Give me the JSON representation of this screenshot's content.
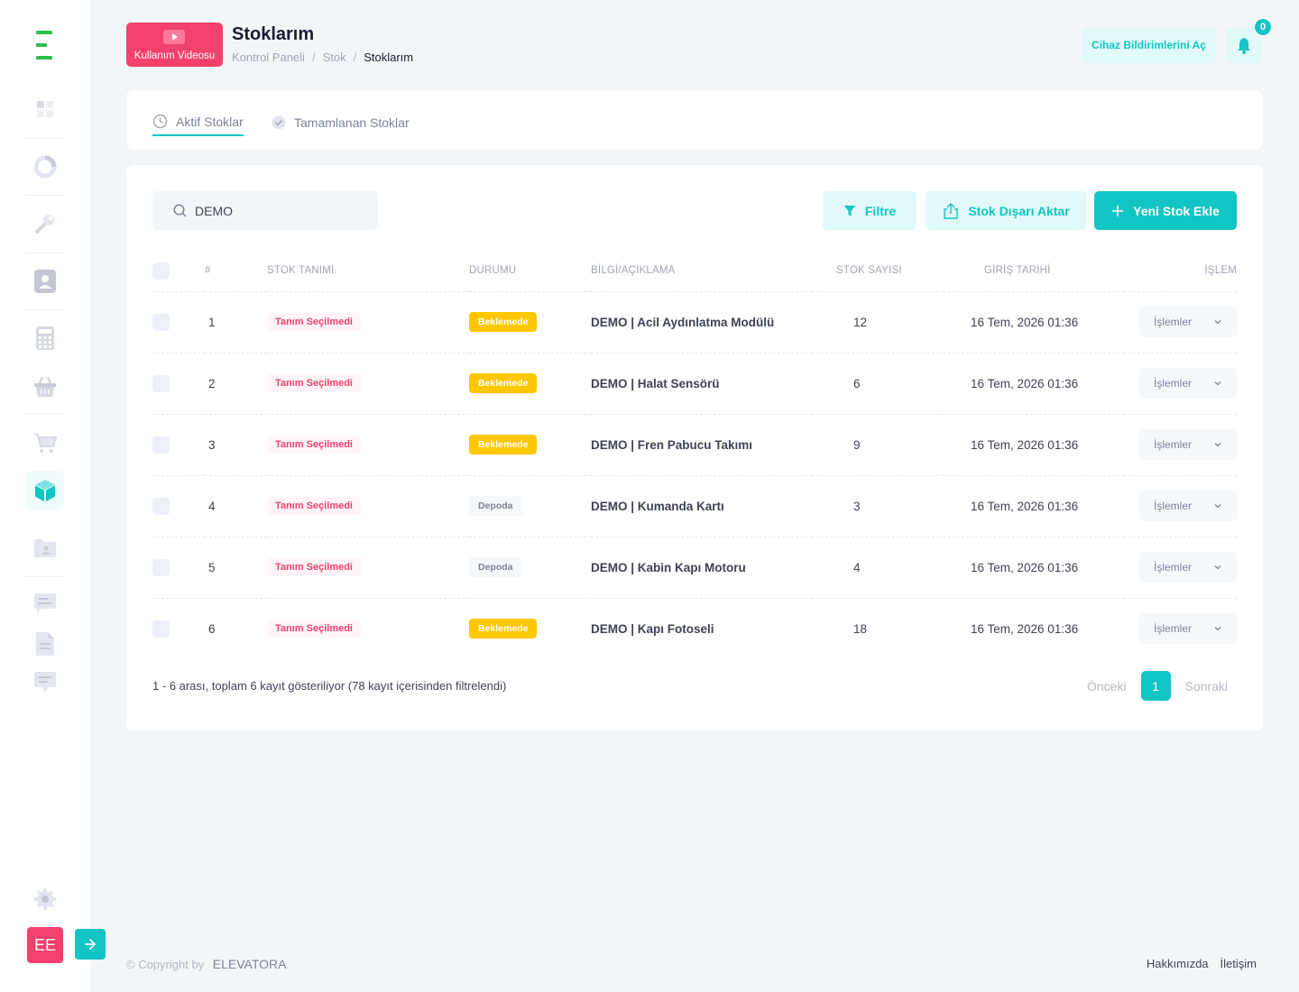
{
  "header": {
    "video_button_label": "Kullanım Videosu",
    "title": "Stoklarım",
    "breadcrumb": [
      "Kontrol Paneli",
      "Stok",
      "Stoklarım"
    ],
    "device_notifications_label": "Cihaz Bildirimlerini Aç",
    "notification_count": "0"
  },
  "tabs": [
    {
      "label": "Aktif Stoklar",
      "active": true
    },
    {
      "label": "Tamamlanan Stoklar",
      "active": false
    }
  ],
  "toolbar": {
    "search_value": "DEMO",
    "filter_label": "Filtre",
    "export_label": "Stok Dışarı Aktar",
    "add_label": "Yeni Stok Ekle"
  },
  "table": {
    "columns": [
      "#",
      "STOK TANIMI",
      "DURUMU",
      "BİLGİ/AÇIKLAMA",
      "STOK SAYISI",
      "GİRİŞ TARİHİ",
      "İŞLEM"
    ],
    "rows": [
      {
        "no": "1",
        "definition": "Tanım Seçilmedi",
        "status": "Beklemede",
        "status_type": "warning",
        "info": "DEMO | Acil Aydınlatma Modülü",
        "count": "12",
        "date": "16 Tem, 2026 01:36",
        "action": "İşlemler"
      },
      {
        "no": "2",
        "definition": "Tanım Seçilmedi",
        "status": "Beklemede",
        "status_type": "warning",
        "info": "DEMO | Halat Sensörü",
        "count": "6",
        "date": "16 Tem, 2026 01:36",
        "action": "İşlemler"
      },
      {
        "no": "3",
        "definition": "Tanım Seçilmedi",
        "status": "Beklemede",
        "status_type": "warning",
        "info": "DEMO | Fren Pabucu Takımı",
        "count": "9",
        "date": "16 Tem, 2026 01:36",
        "action": "İşlemler"
      },
      {
        "no": "4",
        "definition": "Tanım Seçilmedi",
        "status": "Depoda",
        "status_type": "light",
        "info": "DEMO | Kumanda Kartı",
        "count": "3",
        "date": "16 Tem, 2026 01:36",
        "action": "İşlemler"
      },
      {
        "no": "5",
        "definition": "Tanım Seçilmedi",
        "status": "Depoda",
        "status_type": "light",
        "info": "DEMO | Kabin Kapı Motoru",
        "count": "4",
        "date": "16 Tem, 2026 01:36",
        "action": "İşlemler"
      },
      {
        "no": "6",
        "definition": "Tanım Seçilmedi",
        "status": "Beklemede",
        "status_type": "warning",
        "info": "DEMO | Kapı Fotoseli",
        "count": "18",
        "date": "16 Tem, 2026 01:36",
        "action": "İşlemler"
      }
    ],
    "info_text": "1 - 6 arası, toplam 6 kayıt gösteriliyor (78 kayıt içerisinden filtrelendi)"
  },
  "pagination": {
    "prev": "Önceki",
    "current": "1",
    "next": "Sonraki"
  },
  "sidebar": {
    "avatar_initials": "EE",
    "items": [
      "dashboard-icon",
      "chart-icon",
      "wrench-icon",
      "contact-icon",
      "calculator-icon",
      "basket-icon",
      "cart-icon",
      "box-icon",
      "folder-user-icon",
      "message-icon",
      "document-icon",
      "chat-icon",
      "gear-icon"
    ]
  },
  "footer": {
    "copyright": "© Copyright by",
    "brand": "ELEVATORA",
    "links": [
      "Hakkımızda",
      "İletişim"
    ]
  },
  "colors": {
    "accent": "#13c4c4",
    "danger": "#f1416c",
    "warning": "#ffc700",
    "logo": "#2fbf4d"
  }
}
